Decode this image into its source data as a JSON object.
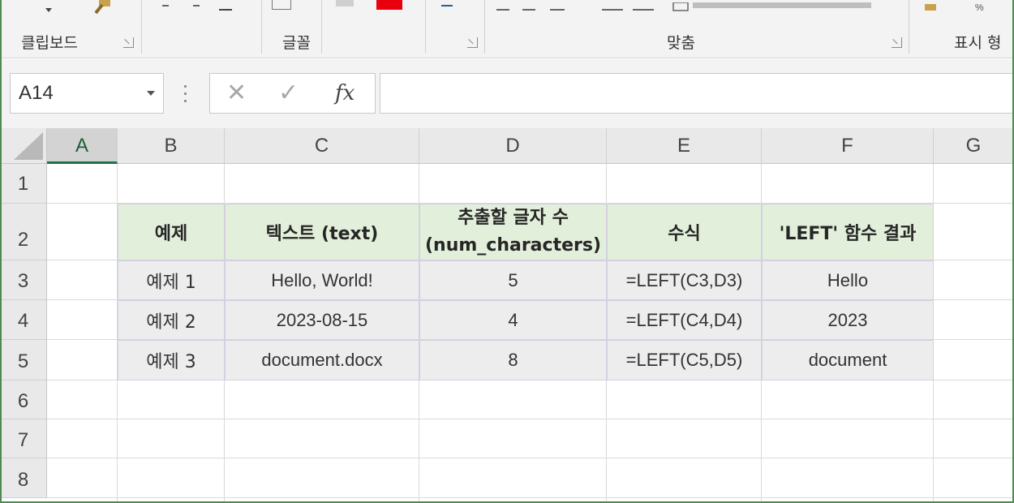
{
  "ribbon": {
    "groups": [
      {
        "label": "클립보드"
      },
      {
        "label": "글꼴"
      },
      {
        "label": "맞춤"
      },
      {
        "label": "표시 형"
      }
    ]
  },
  "formula_bar": {
    "name_box": "A14",
    "cancel_glyph": "✕",
    "enter_glyph": "✓",
    "fx_label": "fx",
    "formula": ""
  },
  "sheet": {
    "columns": [
      "A",
      "B",
      "C",
      "D",
      "E",
      "F",
      "G"
    ],
    "selected_column": "A",
    "rows": [
      "1",
      "2",
      "3",
      "4",
      "5",
      "6",
      "7",
      "8"
    ],
    "table": {
      "headers": [
        "예제",
        "텍스트 (text)",
        "추출할 글자 수",
        "(num_characters)",
        "수식",
        "'LEFT' 함수 결과"
      ],
      "rows": [
        {
          "example": "예제 1",
          "text": "Hello, World!",
          "num": "5",
          "formula": "=LEFT(C3,D3)",
          "result": "Hello"
        },
        {
          "example": "예제 2",
          "text": "2023-08-15",
          "num": "4",
          "formula": "=LEFT(C4,D4)",
          "result": "2023"
        },
        {
          "example": "예제 3",
          "text": "document.docx",
          "num": "8",
          "formula": "=LEFT(C5,D5)",
          "result": "document"
        }
      ]
    }
  },
  "colors": {
    "header_fill": "#e2efda",
    "data_fill": "#ededed",
    "accent": "#217346"
  }
}
